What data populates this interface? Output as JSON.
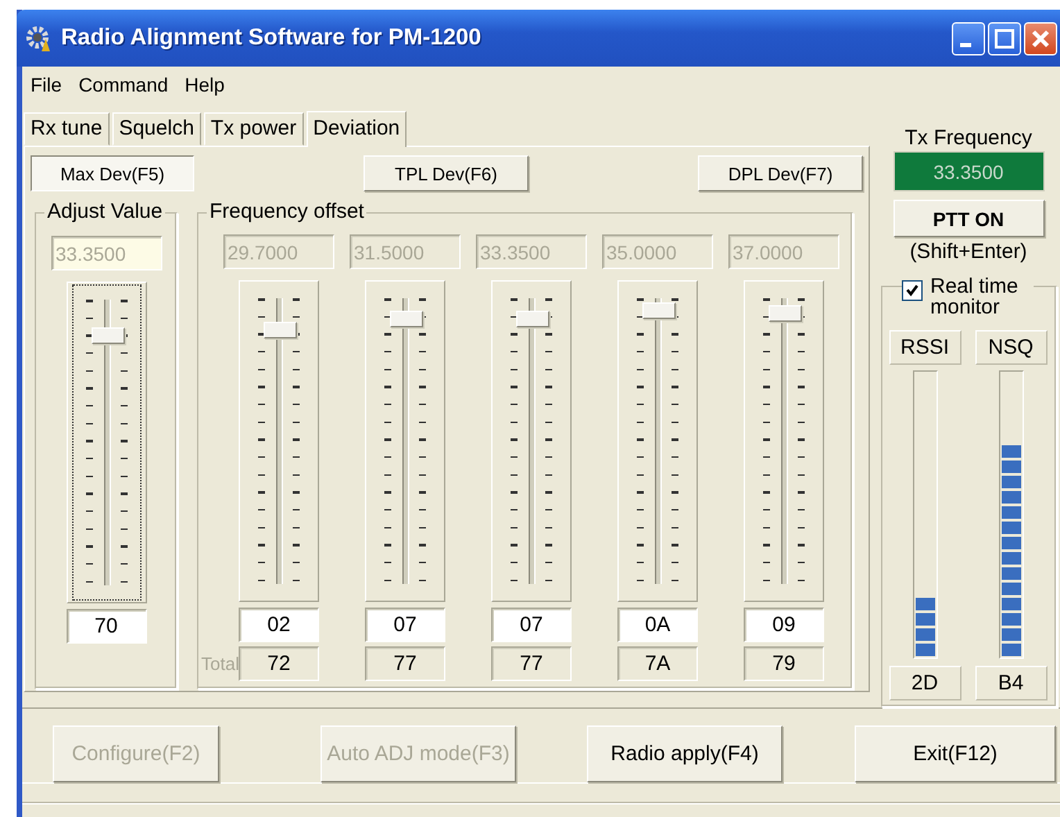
{
  "window": {
    "title": "Radio Alignment Software for PM-1200"
  },
  "menu": [
    "File",
    "Command",
    "Help"
  ],
  "tabs": [
    {
      "label": "Rx tune",
      "selected": false
    },
    {
      "label": "Squelch",
      "selected": false
    },
    {
      "label": "Tx power",
      "selected": false
    },
    {
      "label": "Deviation",
      "selected": true
    }
  ],
  "mode_buttons": [
    {
      "label": "Max Dev(F5)",
      "selected": true
    },
    {
      "label": "TPL Dev(F6)",
      "selected": false
    },
    {
      "label": "DPL Dev(F7)",
      "selected": false
    }
  ],
  "adjust_value": {
    "title": "Adjust Value",
    "frequency": "33.3500",
    "level": 0.87,
    "value": "70"
  },
  "frequency_offset": {
    "title": "Frequency offset",
    "total_label": "Total",
    "channels": [
      {
        "frequency": "29.7000",
        "level": 0.89,
        "value": "02",
        "total": "72"
      },
      {
        "frequency": "31.5000",
        "level": 0.93,
        "value": "07",
        "total": "77"
      },
      {
        "frequency": "33.3500",
        "level": 0.93,
        "value": "07",
        "total": "77"
      },
      {
        "frequency": "35.0000",
        "level": 0.96,
        "value": "0A",
        "total": "7A"
      },
      {
        "frequency": "37.0000",
        "level": 0.95,
        "value": "09",
        "total": "79"
      }
    ]
  },
  "tx": {
    "title": "Tx Frequency",
    "frequency": "33.3500",
    "ptt_button": "PTT ON",
    "ptt_hint": "(Shift+Enter)"
  },
  "monitor": {
    "label": "Real time monitor",
    "checked": true,
    "meters": [
      {
        "name": "RSSI",
        "level": 0.21,
        "reading": "2D"
      },
      {
        "name": "NSQ",
        "level": 0.74,
        "reading": "B4"
      }
    ]
  },
  "buttons": [
    {
      "label": "Configure(F2)",
      "disabled": true
    },
    {
      "label": "Auto ADJ mode(F3)",
      "disabled": true
    },
    {
      "label": "Radio apply(F4)",
      "disabled": false
    },
    {
      "label": "Exit(F12)",
      "disabled": false
    }
  ]
}
